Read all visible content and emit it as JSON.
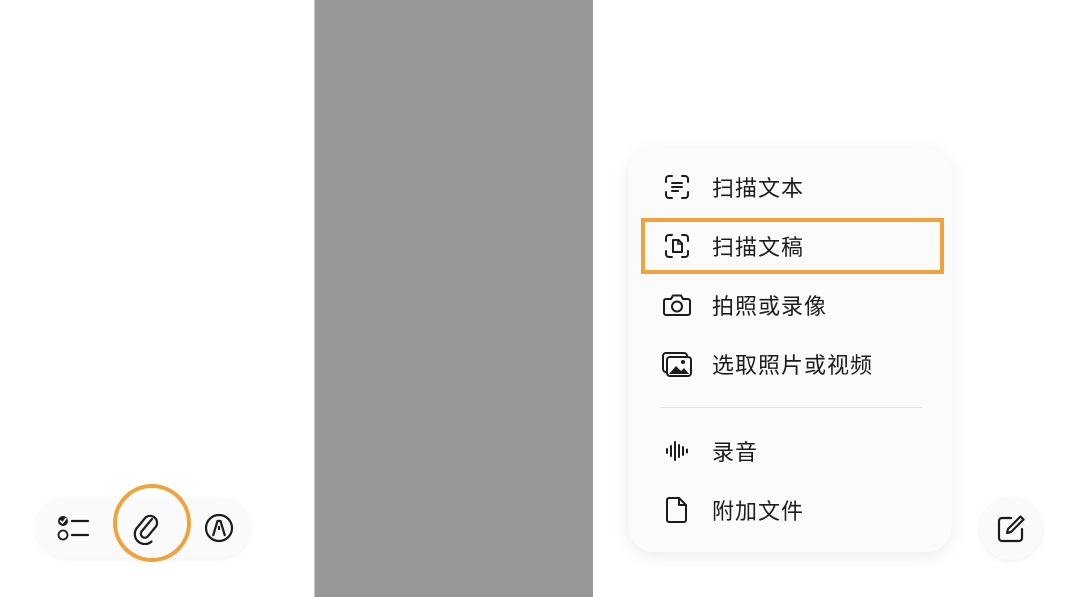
{
  "toolbar": {
    "checklist_icon": "checklist-icon",
    "attach_icon": "paperclip-icon",
    "markup_icon": "pen-markup-icon"
  },
  "attach_menu": {
    "items": [
      {
        "label": "扫描文本",
        "icon": "scan-text-icon"
      },
      {
        "label": "扫描文稿",
        "icon": "scan-document-icon"
      },
      {
        "label": "拍照或录像",
        "icon": "camera-icon"
      },
      {
        "label": "选取照片或视频",
        "icon": "photo-library-icon"
      },
      {
        "label": "录音",
        "icon": "waveform-icon"
      },
      {
        "label": "附加文件",
        "icon": "document-icon"
      }
    ]
  },
  "compose": {
    "icon": "compose-icon"
  },
  "colors": {
    "highlight": "#f0a33d",
    "divider_panel": "#989898",
    "text": "#1c1c1e"
  }
}
